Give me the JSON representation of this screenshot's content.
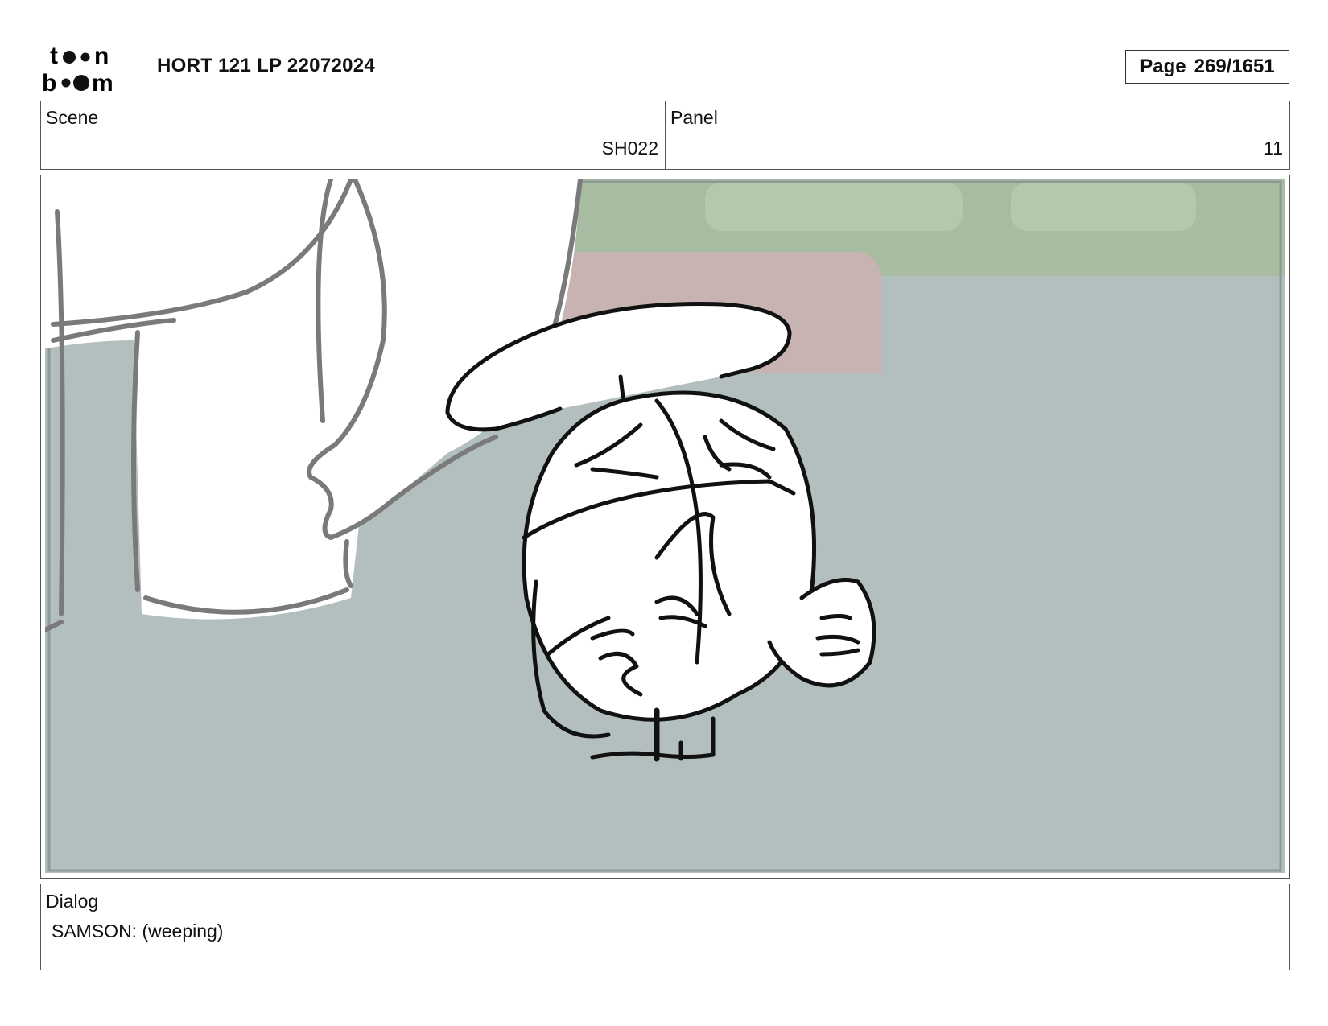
{
  "header": {
    "logo_text_top": "toon",
    "logo_text_bottom": "boom",
    "title": "HORT 121 LP 22072024",
    "page_label": "Page",
    "page_value": "269/1651"
  },
  "info": {
    "scene_label": "Scene",
    "scene_value": "SH022",
    "panel_label": "Panel",
    "panel_value": "11"
  },
  "dialog": {
    "label": "Dialog",
    "text": "SAMSON: (weeping)"
  },
  "colors": {
    "floor": "#b3bfbf",
    "wall": "#a8bca2",
    "rug": "#c7b4b2",
    "sketch_black": "#111111",
    "sketch_grey": "#7a7a7a"
  }
}
